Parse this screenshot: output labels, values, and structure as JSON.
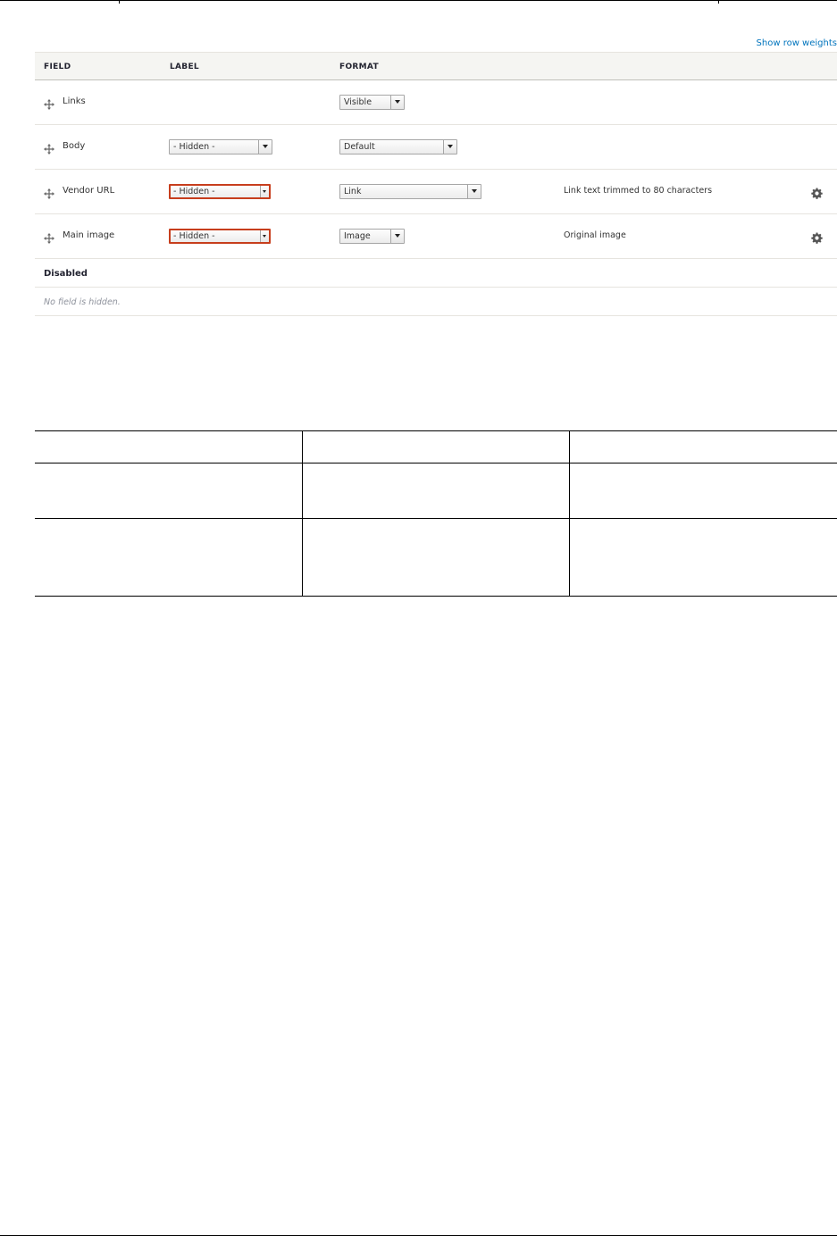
{
  "toolbar": {
    "show_row_weights": "Show row weights"
  },
  "table": {
    "headers": {
      "field": "FIELD",
      "label": "LABEL",
      "format": "FORMAT"
    },
    "rows": [
      {
        "field": "Links",
        "label": null,
        "format": "Visible",
        "summary": null,
        "has_settings": false
      },
      {
        "field": "Body",
        "label": "- Hidden -",
        "format": "Default",
        "summary": null,
        "has_settings": false
      },
      {
        "field": "Vendor URL",
        "label": "- Hidden -",
        "label_highlighted": true,
        "format": "Link",
        "summary": "Link text trimmed to 80 characters",
        "has_settings": true
      },
      {
        "field": "Main image",
        "label": "- Hidden -",
        "label_highlighted": true,
        "format": "Image",
        "summary": "Original image",
        "has_settings": true
      }
    ],
    "disabled_region": {
      "title": "Disabled",
      "empty_message": "No field is hidden."
    }
  },
  "icons": {
    "drag": "move-icon",
    "settings": "gear-icon",
    "dropdown": "chevron-down-icon"
  },
  "colors": {
    "link": "#0074bd",
    "error_border": "#c73e1d",
    "header_bg": "#f5f5f2"
  }
}
